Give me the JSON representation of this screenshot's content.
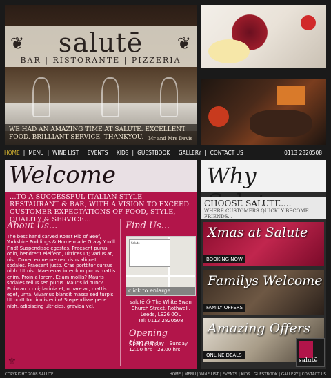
{
  "brand": {
    "logo": "salutē",
    "tagline": "BAR | RISTORANTE | PIZZERIA",
    "footer_logo": "salutē"
  },
  "hero": {
    "quote": "WE HAD AN AMAZING TIME AT SALUTE. EXCELLENT FOOD. BRILLIANT SERVICE. THANKYOU.",
    "quote_by": "Mr and Mrs Davis"
  },
  "nav": {
    "items": [
      "HOME",
      "MENU",
      "WINE LIST",
      "EVENTS",
      "KIDS",
      "GUESTBOOK",
      "GALLERY",
      "CONTACT US"
    ],
    "phone": "0113 2820508"
  },
  "welcome": {
    "title": "Welcome",
    "intro": "...to a successful Italian style Restaurant & bar, with a vision to exceed customer expectations of food, style, quality & service..."
  },
  "about": {
    "heading": "About Us...",
    "text": "The best hand carved Roast Rib of Beef, Yorkshire Puddings & Home made Gravy You'll Find! Suspendisse egestas. Praesent purus odio, hendrerit eleifend, ultrices ut; varius at, nisi. Donec eu neque nec risus aliquet sodales. Praesent justo. Cras porttitor cursus nibh. Ut nisi. Maecenas interdum purus mattis enim. Proin a lorem. Etiam mollis? Mauris sodales tellus sed purus. Mauris id nunc? Proin arcu dui; lacinia et, ornare ac, mattis eget, urna. Vivamus blandit massa sed turpis. Ut porttitor. iculis enim! Suspendisse pede nibh, adipiscing ultricies, gravida vel."
  },
  "find": {
    "heading": "Find Us...",
    "map_label": "click to enlarge",
    "map_popup_title": "Salute",
    "address": "salutē @ The White Swan Church Street, Rothwell, Leeds, LS26 0QL",
    "tel": "Tel: 0113 2820508"
  },
  "hours": {
    "heading": "Opening times...",
    "text": "Open: Monday – Sunday 12.00 hrs – 23.00 hrs"
  },
  "why": {
    "title": "Why Salute..."
  },
  "choose": {
    "title": "CHOOSE SALUTE....",
    "subtitle": "WHERE CUSTOMERS QUICKLY BECOME FRIENDS..."
  },
  "promos": [
    {
      "title": "Xmas at Salute",
      "tag": "BOOKING NOW"
    },
    {
      "title": "Familys Welcome",
      "tag": "FAMILY OFFERS"
    },
    {
      "title": "Amazing Offers",
      "tag": "ONLINE DEALS"
    }
  ],
  "footer": {
    "copyright": "COPYRIGHT 2008 SALUTE",
    "nav": "HOME | MENU | WINE LIST | EVENTS | KIDS | GUESTBOOK | GALLERY | CONTACT US"
  },
  "colors": {
    "accent": "#b2154a",
    "gold": "#d7b531",
    "dark": "#1a1a1a"
  }
}
